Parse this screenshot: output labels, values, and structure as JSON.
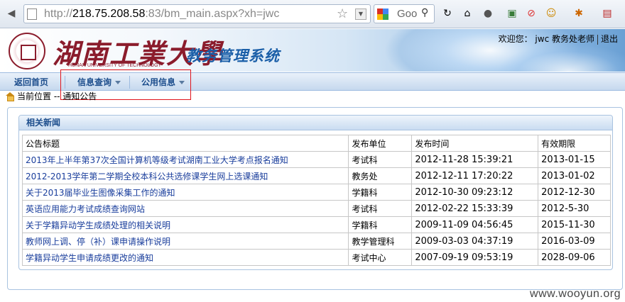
{
  "browser": {
    "url_prefix": "http://",
    "url_host": "218.75.208.58",
    "url_rest": ":83/bm_main.aspx?xh=jwc",
    "search_placeholder": "Goo"
  },
  "header": {
    "university_name": "湖南工業大學",
    "university_en": "HUNAN UNIVERSITY OF TECHNOLOGY",
    "system_name": "教务管理系统",
    "welcome_label": "欢迎您：",
    "user_name": "jwc 教务处老师",
    "logout_label": "退出"
  },
  "menu": {
    "home": "返回首页",
    "info_query": "信息查询",
    "public_info": "公用信息"
  },
  "breadcrumb": "当前位置 -- 通知公告",
  "news": {
    "panel_title": "相关新闻",
    "columns": [
      "公告标题",
      "发布单位",
      "发布时间",
      "有效期限"
    ],
    "rows": [
      {
        "title": "2013年上半年第37次全国计算机等级考试湖南工业大学考点报名通知",
        "unit": "考试科",
        "time": "2012-11-28 15:39:21",
        "expiry": "2013-01-15"
      },
      {
        "title": "2012-2013学年第二学期全校本科公共选修课学生网上选课通知",
        "unit": "教务处",
        "time": "2012-12-11 17:20:22",
        "expiry": "2013-01-02"
      },
      {
        "title": "关于2013届毕业生图像采集工作的通知",
        "unit": "学籍科",
        "time": "2012-10-30 09:23:12",
        "expiry": "2012-12-30"
      },
      {
        "title": "英语应用能力考试成绩查询网站",
        "unit": "考试科",
        "time": "2012-02-22 15:33:39",
        "expiry": "2012-5-30"
      },
      {
        "title": "关于学籍异动学生成绩处理的相关说明",
        "unit": "学籍科",
        "time": "2009-11-09 04:56:45",
        "expiry": "2015-11-30"
      },
      {
        "title": "教师网上调、停（补）课申请操作说明",
        "unit": "教学管理科",
        "time": "2009-03-03 04:37:19",
        "expiry": "2016-03-09"
      },
      {
        "title": "学籍异动学生申请成绩更改的通知",
        "unit": "考试中心",
        "time": "2007-09-19 09:53:19",
        "expiry": "2028-09-06"
      }
    ]
  },
  "watermark": "www.wooyun.org",
  "colors": {
    "accent": "#1c4d8c",
    "univ_red": "#8b1c2c",
    "highlight_box": "#e0141b",
    "link": "#1a3e9c"
  }
}
